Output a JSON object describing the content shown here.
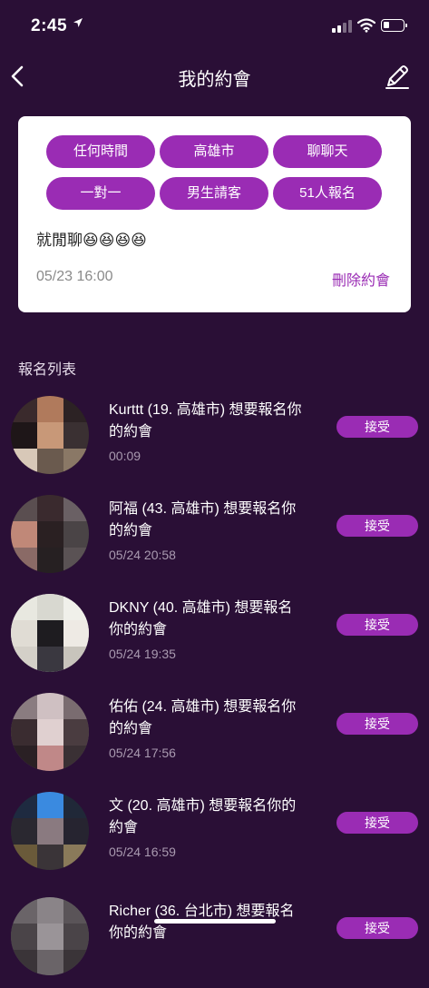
{
  "status_bar": {
    "time": "2:45"
  },
  "nav": {
    "title": "我的約會"
  },
  "card": {
    "tags": [
      "任何時間",
      "高雄市",
      "聊聊天",
      "一對一",
      "男生請客",
      "51人報名"
    ],
    "text": "就閒聊😆😆😆😆",
    "date": "05/23 16:00",
    "delete_label": "刪除約會"
  },
  "section_title": "報名列表",
  "applicants": [
    {
      "line1": "Kurttt (19. 高雄市) 想要報名你",
      "line2": "的約會",
      "time": "00:09",
      "accept": "接受"
    },
    {
      "line1": "阿福 (43. 高雄市) 想要報名你",
      "line2": "的約會",
      "time": "05/24 20:58",
      "accept": "接受"
    },
    {
      "line1": "DKNY (40. 高雄市) 想要報名",
      "line2": "你的約會",
      "time": "05/24 19:35",
      "accept": "接受"
    },
    {
      "line1": "佑佑 (24. 高雄市) 想要報名你",
      "line2": "的約會",
      "time": "05/24 17:56",
      "accept": "接受"
    },
    {
      "line1": "文 (20. 高雄市) 想要報名你的",
      "line2": "約會",
      "time": "05/24 16:59",
      "accept": "接受"
    },
    {
      "line1": "Richer (36. 台北市) 想要報名",
      "line2": "你的約會",
      "time": "",
      "accept": "接受"
    }
  ],
  "colors": {
    "background": "#2a0f36",
    "accent": "#9a2cb4",
    "card": "#ffffff"
  }
}
